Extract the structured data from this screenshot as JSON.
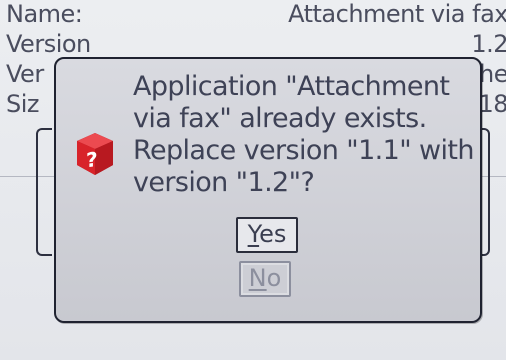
{
  "background": {
    "rows": [
      {
        "label": "Name:",
        "value": "Attachment via fax"
      },
      {
        "label": "Version",
        "value": "1.2"
      },
      {
        "label": "Ver",
        "value": "he"
      },
      {
        "label": "Siz",
        "value": "18"
      }
    ]
  },
  "dialog": {
    "icon": "question-cube-icon",
    "message": "Application \"Attachment\nvia fax\" already exists.\nReplace version \"1.1\" with\nversion \"1.2\"?",
    "buttons": {
      "yes": {
        "mnemonic": "Y",
        "rest": "es"
      },
      "no": {
        "mnemonic": "N",
        "rest": "o"
      }
    }
  },
  "colors": {
    "icon_red": "#d8232a",
    "dialog_border": "#1f2230",
    "text": "#3e4256"
  }
}
